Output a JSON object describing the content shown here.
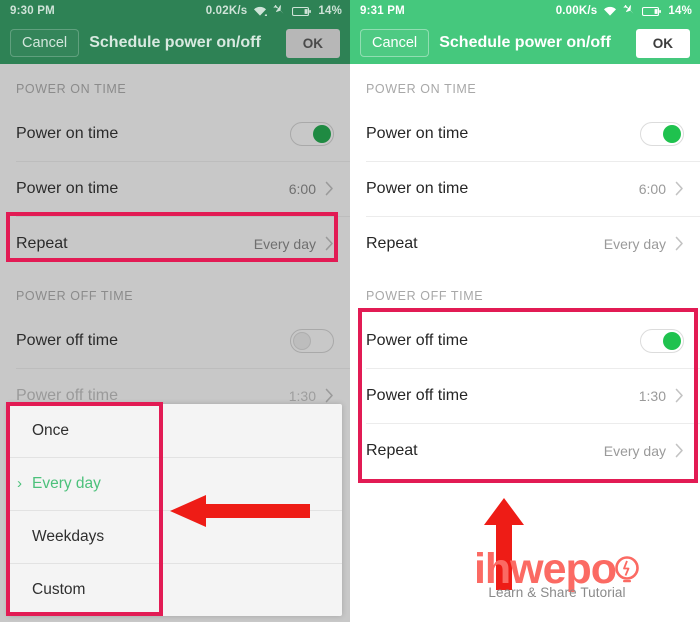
{
  "panels": [
    {
      "id": "left",
      "statusbar": {
        "time": "9:30 PM",
        "network_speed": "0.02K/s",
        "wifi_icon": "wifi-icon",
        "airplane_icon": "airplane-mode-icon",
        "battery_icon": "battery-icon",
        "battery_level": "14%"
      },
      "toolbar": {
        "cancel_label": "Cancel",
        "title": "Schedule power on/off",
        "ok_label": "OK"
      },
      "sections": [
        {
          "header": "POWER ON TIME",
          "rows": [
            {
              "label": "Power on time",
              "control": "toggle",
              "toggle_on": true
            },
            {
              "label": "Power on time",
              "control": "value",
              "value": "6:00",
              "chevron": "chevron-right-icon"
            },
            {
              "label": "Repeat",
              "control": "value",
              "value": "Every day",
              "chevron": "chevron-right-icon",
              "highlighted": true
            }
          ]
        },
        {
          "header": "POWER OFF TIME",
          "rows": [
            {
              "label": "Power off time",
              "control": "toggle",
              "toggle_on": false
            },
            {
              "label": "Power off time",
              "control": "value",
              "value": "1:30",
              "chevron": "chevron-right-icon",
              "faded": true
            }
          ]
        }
      ],
      "sheet": {
        "options": [
          {
            "label": "Once",
            "selected": false
          },
          {
            "label": "Every day",
            "selected": true
          },
          {
            "label": "Weekdays",
            "selected": false
          },
          {
            "label": "Custom",
            "selected": false
          }
        ]
      }
    },
    {
      "id": "right",
      "statusbar": {
        "time": "9:31 PM",
        "network_speed": "0.00K/s",
        "wifi_icon": "wifi-icon",
        "airplane_icon": "airplane-mode-icon",
        "battery_icon": "battery-icon",
        "battery_level": "14%"
      },
      "toolbar": {
        "cancel_label": "Cancel",
        "title": "Schedule power on/off",
        "ok_label": "OK"
      },
      "sections": [
        {
          "header": "POWER ON TIME",
          "rows": [
            {
              "label": "Power on time",
              "control": "toggle",
              "toggle_on": true
            },
            {
              "label": "Power on time",
              "control": "value",
              "value": "6:00",
              "chevron": "chevron-right-icon"
            },
            {
              "label": "Repeat",
              "control": "value",
              "value": "Every day",
              "chevron": "chevron-right-icon"
            }
          ]
        },
        {
          "header": "POWER OFF TIME",
          "rows": [
            {
              "label": "Power off time",
              "control": "toggle",
              "toggle_on": true
            },
            {
              "label": "Power off time",
              "control": "value",
              "value": "1:30",
              "chevron": "chevron-right-icon"
            },
            {
              "label": "Repeat",
              "control": "value",
              "value": "Every day",
              "chevron": "chevron-right-icon"
            }
          ]
        }
      ]
    }
  ],
  "annotations": {
    "highlight_color": "#e21b54",
    "arrow_color": "#ee1c16",
    "left_arrow_icon": "left-arrow-annotation",
    "up_arrow_icon": "up-arrow-annotation"
  },
  "watermark": {
    "brand": "ihwepo",
    "tagline": "Learn & Share Tutorial",
    "bulb_icon": "lightbulb-icon",
    "brand_color": "#fb6a63"
  }
}
